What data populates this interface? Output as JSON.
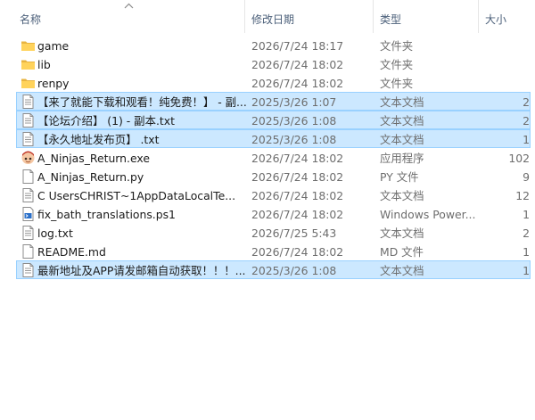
{
  "columns": {
    "name": "名称",
    "modified": "修改日期",
    "type": "类型",
    "size": "大小"
  },
  "rows": [
    {
      "icon": "folder-icon",
      "name": "game",
      "date": "2026/7/24 18:17",
      "type": "文件夹",
      "size": "",
      "selected": false
    },
    {
      "icon": "folder-icon",
      "name": "lib",
      "date": "2026/7/24 18:02",
      "type": "文件夹",
      "size": "",
      "selected": false
    },
    {
      "icon": "folder-icon",
      "name": "renpy",
      "date": "2026/7/24 18:02",
      "type": "文件夹",
      "size": "",
      "selected": false
    },
    {
      "icon": "text-file-icon",
      "name": "【来了就能下载和观看！纯免费！】 - 副...",
      "date": "2025/3/26 1:07",
      "type": "文本文档",
      "size": "2",
      "selected": true
    },
    {
      "icon": "text-file-icon",
      "name": "【论坛介绍】 (1) - 副本.txt",
      "date": "2025/3/26 1:08",
      "type": "文本文档",
      "size": "2",
      "selected": true
    },
    {
      "icon": "text-file-icon",
      "name": "【永久地址发布页】 .txt",
      "date": "2025/3/26 1:08",
      "type": "文本文档",
      "size": "1",
      "selected": true
    },
    {
      "icon": "app-exe-icon",
      "name": "A_Ninjas_Return.exe",
      "date": "2026/7/24 18:02",
      "type": "应用程序",
      "size": "102",
      "selected": false
    },
    {
      "icon": "blank-file-icon",
      "name": "A_Ninjas_Return.py",
      "date": "2026/7/24 18:02",
      "type": "PY 文件",
      "size": "9",
      "selected": false
    },
    {
      "icon": "text-file-icon",
      "name": "C   UsersCHRIST~1AppDataLocalTe...",
      "date": "2026/7/24 18:02",
      "type": "文本文档",
      "size": "12",
      "selected": false
    },
    {
      "icon": "powershell-script-icon",
      "name": "fix_bath_translations.ps1",
      "date": "2026/7/24 18:02",
      "type": "Windows Power...",
      "size": "1",
      "selected": false
    },
    {
      "icon": "text-file-icon",
      "name": "log.txt",
      "date": "2026/7/25 5:43",
      "type": "文本文档",
      "size": "2",
      "selected": false
    },
    {
      "icon": "blank-file-icon",
      "name": "README.md",
      "date": "2026/7/24 18:02",
      "type": "MD 文件",
      "size": "1",
      "selected": false
    },
    {
      "icon": "text-file-icon",
      "name": "最新地址及APP请发邮箱自动获取！！！...",
      "date": "2025/3/26 1:08",
      "type": "文本文档",
      "size": "1",
      "selected": true
    }
  ]
}
